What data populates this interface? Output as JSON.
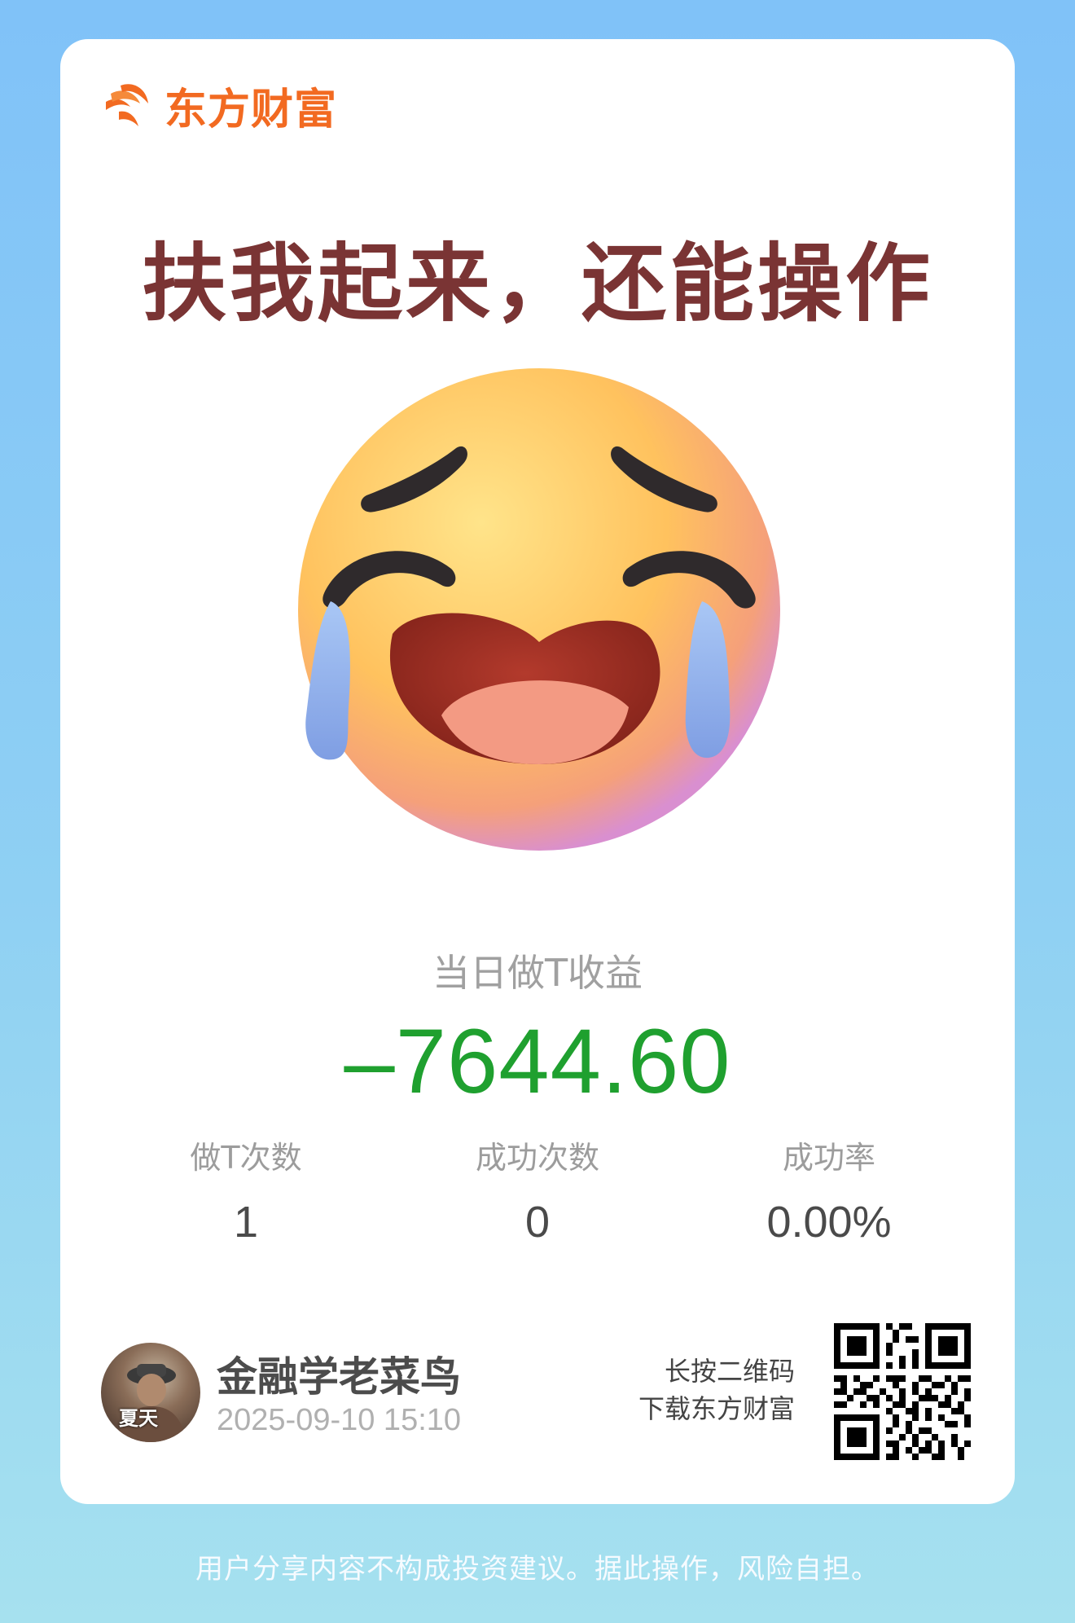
{
  "brand": {
    "name": "东方财富",
    "logo_icon": "dfcf-flame-icon"
  },
  "headline": "扶我起来，还能操作",
  "emoji_icon": "crying-face-icon",
  "profit": {
    "label": "当日做T收益",
    "value": "–7644.60"
  },
  "stats": [
    {
      "label": "做T次数",
      "value": "1"
    },
    {
      "label": "成功次数",
      "value": "0"
    },
    {
      "label": "成功率",
      "value": "0.00%"
    }
  ],
  "user": {
    "name": "金融学老菜鸟",
    "time": "2025-09-10 15:10",
    "avatar_text": "夏天"
  },
  "qr": {
    "tip_line1": "长按二维码",
    "tip_line2": "下载东方财富"
  },
  "disclaimer": "用户分享内容不构成投资建议。据此操作，风险自担。",
  "colors": {
    "brand": "#f26a21",
    "headline": "#7a3434",
    "loss": "#1fa02f",
    "background_top": "#80c2f8",
    "background_bottom": "#a6e1ef"
  }
}
